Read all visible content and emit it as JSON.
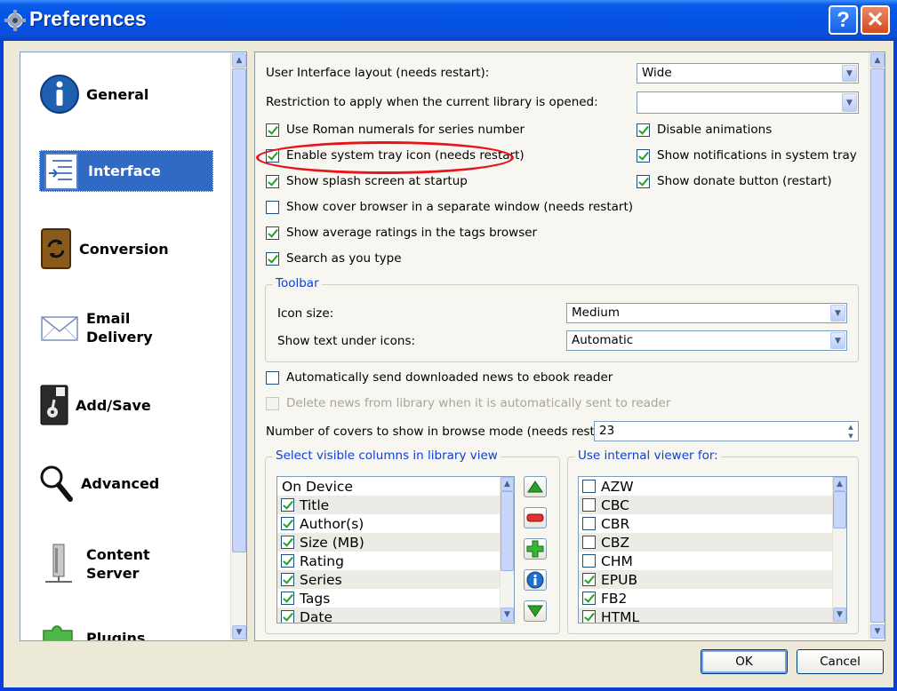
{
  "window": {
    "title": "Preferences"
  },
  "titlebar": {
    "help_glyph": "?",
    "close_glyph": "✕"
  },
  "nav": {
    "items": [
      {
        "label": "General",
        "icon": "info-icon"
      },
      {
        "label": "Interface",
        "icon": "interface-icon",
        "selected": true
      },
      {
        "label": "Conversion",
        "icon": "conversion-icon"
      },
      {
        "label": "Email Delivery",
        "label_line1": "Email",
        "label_line2": "Delivery",
        "icon": "email-icon"
      },
      {
        "label": "Add/Save",
        "icon": "disk-icon"
      },
      {
        "label": "Advanced",
        "icon": "magnifier-icon"
      },
      {
        "label": "Content Server",
        "label_line1": "Content",
        "label_line2": "Server",
        "icon": "server-icon"
      },
      {
        "label": "Plugins",
        "icon": "plugin-icon"
      }
    ]
  },
  "interface": {
    "layout_label": "User Interface layout (needs restart):",
    "layout_value": "Wide",
    "restriction_label": "Restriction to apply when the current library is opened:",
    "restriction_value": "",
    "checkboxes_left": [
      {
        "label": "Use Roman numerals for series number",
        "checked": true
      },
      {
        "label": "Enable system tray icon (needs restart)",
        "checked": true
      },
      {
        "label": "Show splash screen at startup",
        "checked": true
      },
      {
        "label": "Show cover browser in a separate window (needs restart)",
        "checked": false
      },
      {
        "label": "Show average ratings in the tags browser",
        "checked": true
      },
      {
        "label": "Search as you type",
        "checked": true
      }
    ],
    "checkboxes_right": [
      {
        "label": "Disable animations",
        "checked": true
      },
      {
        "label": "Show notifications in system tray",
        "checked": true
      },
      {
        "label": "Show donate button (restart)",
        "checked": true
      }
    ],
    "toolbar": {
      "title": "Toolbar",
      "icon_size_label": "Icon size:",
      "icon_size_value": "Medium",
      "text_under_label": "Show text under icons:",
      "text_under_value": "Automatic"
    },
    "auto_send_label": "Automatically send downloaded news to ebook reader",
    "auto_send_checked": false,
    "delete_news_label": "Delete news from library when it is automatically sent to reader",
    "delete_news_checked": false,
    "covers_label": "Number of covers to show in browse mode (needs restart):",
    "covers_value": "23",
    "columns": {
      "title": "Select visible columns in library view",
      "items": [
        {
          "label": "On Device",
          "checked": null
        },
        {
          "label": "Title",
          "checked": true
        },
        {
          "label": "Author(s)",
          "checked": true
        },
        {
          "label": "Size (MB)",
          "checked": true
        },
        {
          "label": "Rating",
          "checked": true
        },
        {
          "label": "Series",
          "checked": true
        },
        {
          "label": "Tags",
          "checked": true
        },
        {
          "label": "Date",
          "checked": true
        }
      ]
    },
    "viewer": {
      "title": "Use internal viewer for:",
      "items": [
        {
          "label": "AZW",
          "checked": false
        },
        {
          "label": "CBC",
          "checked": false
        },
        {
          "label": "CBR",
          "checked": false
        },
        {
          "label": "CBZ",
          "checked": false
        },
        {
          "label": "CHM",
          "checked": false
        },
        {
          "label": "EPUB",
          "checked": true
        },
        {
          "label": "FB2",
          "checked": true
        },
        {
          "label": "HTML",
          "checked": true
        }
      ]
    }
  },
  "buttons": {
    "ok": "OK",
    "cancel": "Cancel"
  },
  "colors": {
    "titlebar": "#0453e6",
    "selection": "#316ac5",
    "highlight_ring": "#e8141a",
    "group_title": "#1040d0"
  }
}
